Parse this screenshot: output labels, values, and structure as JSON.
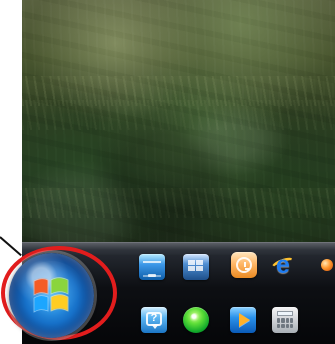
{
  "screen": {
    "type": "desktop-taskbar-start-button-zoom"
  },
  "wallpaper": {
    "subject": "green-grass-and-foliage"
  },
  "annotation": {
    "color": "#e21d1d"
  },
  "start_button": {
    "icon": "windows-logo-icon"
  },
  "taskbar": {
    "top_row": [
      {
        "icon": "monitor-icon"
      },
      {
        "icon": "windows-icon"
      },
      {
        "icon": "clock-icon"
      },
      {
        "icon": "internet-explorer-icon"
      },
      {
        "icon": "app-icon"
      }
    ],
    "bottom_row": [
      {
        "icon": "help-icon"
      },
      {
        "icon": "green-orb-icon"
      },
      {
        "icon": "play-icon"
      },
      {
        "icon": "calculator-icon"
      }
    ]
  }
}
